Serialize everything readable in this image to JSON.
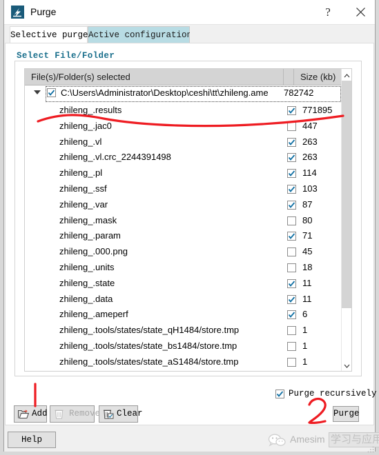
{
  "window": {
    "title": "Purge",
    "icon": "app-purge-icon",
    "help_glyph": "?",
    "close_glyph": "✕"
  },
  "tabs": [
    {
      "label": "Selective purge",
      "selected": true
    },
    {
      "label": "Active configuration",
      "selected": false
    }
  ],
  "group": {
    "title": "Select File/Folder"
  },
  "tree": {
    "columns": [
      "File(s)/Folder(s) selected",
      "Size (kb)"
    ],
    "root": {
      "label": "C:\\Users\\Administrator\\Desktop\\ceshi\\tt\\zhileng.ame",
      "size": "782742",
      "checked": true,
      "expanded": true
    },
    "children": [
      {
        "label": "zhileng_.results",
        "size": "771895",
        "checked": true
      },
      {
        "label": "zhileng_.jac0",
        "size": "447",
        "checked": false
      },
      {
        "label": "zhileng_.vl",
        "size": "263",
        "checked": true
      },
      {
        "label": "zhileng_.vl.crc_2244391498",
        "size": "263",
        "checked": true
      },
      {
        "label": "zhileng_.pl",
        "size": "114",
        "checked": true
      },
      {
        "label": "zhileng_.ssf",
        "size": "103",
        "checked": true
      },
      {
        "label": "zhileng_.var",
        "size": "87",
        "checked": true
      },
      {
        "label": "zhileng_.mask",
        "size": "80",
        "checked": false
      },
      {
        "label": "zhileng_.param",
        "size": "71",
        "checked": true
      },
      {
        "label": "zhileng_.000.png",
        "size": "45",
        "checked": false
      },
      {
        "label": "zhileng_.units",
        "size": "18",
        "checked": false
      },
      {
        "label": "zhileng_.state",
        "size": "11",
        "checked": true
      },
      {
        "label": "zhileng_.data",
        "size": "11",
        "checked": true
      },
      {
        "label": "zhileng_.ameperf",
        "size": "6",
        "checked": true
      },
      {
        "label": "zhileng_.tools/states/state_qH1484/store.tmp",
        "size": "1",
        "checked": false
      },
      {
        "label": "zhileng_.tools/states/state_bs1484/store.tmp",
        "size": "1",
        "checked": false
      },
      {
        "label": "zhileng_.tools/states/state_aS1484/store.tmp",
        "size": "1",
        "checked": false
      }
    ],
    "scrollbar": {
      "up_glyph": "⌃",
      "down_glyph": "⌄"
    }
  },
  "options": {
    "purge_recursively_label": "Purge recursively",
    "purge_recursively_checked": true
  },
  "buttons": {
    "add": "Add",
    "remove": "Remove",
    "clear": "Clear",
    "purge": "Purge",
    "help": "Help"
  },
  "watermark": {
    "brand": "Amesim",
    "cn": "学习与应用"
  },
  "colors": {
    "tab_active_bg": "#ffffff",
    "tab_inactive_bg": "#b8dce4",
    "group_title": "#1a6f8c",
    "header_bg": "#d4d4d4",
    "checkbox_check": "#0f6fa3",
    "annotation_red": "#ee1c22",
    "titlebar_icon_bg": "#1a5b7a"
  }
}
